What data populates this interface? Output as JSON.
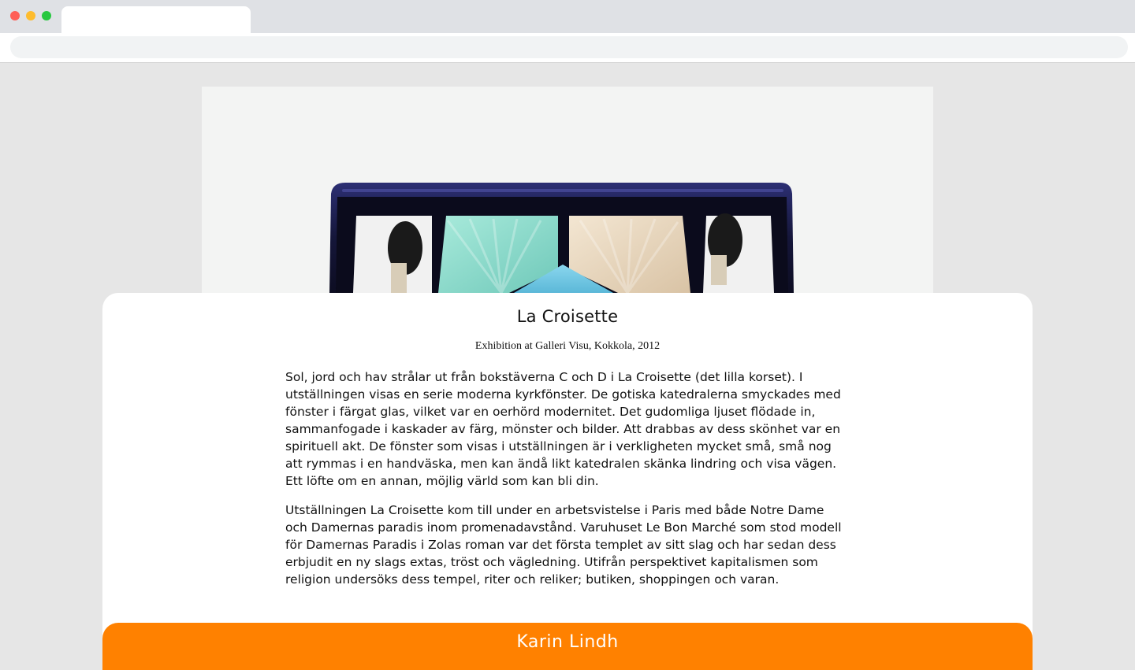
{
  "colors": {
    "accent": "#ff8100",
    "page_background": "#e6e6e6",
    "card_background": "#ffffff",
    "hero_background": "#f3f4f3"
  },
  "hero": {
    "image_subject": "eyeshadow-palette",
    "palette_colors": [
      "#1c1d4a",
      "#8fdccd",
      "#e8d7c0",
      "#6fc6e2"
    ]
  },
  "article": {
    "title": "La Croisette",
    "subtitle": "Exhibition at Galleri Visu, Kokkola, 2012",
    "paragraphs": [
      "Sol, jord och hav strålar ut från bokstäverna C och D i La Croisette (det lilla korset). I utställningen visas en serie moderna kyrkfönster. De gotiska katedralerna smyckades med fönster i färgat glas, vilket var en oerhörd modernitet. Det gudomliga ljuset flödade in, sammanfogade i kaskader av färg, mönster och bilder. Att drabbas av dess skönhet var en spirituell akt. De fönster som visas i utställningen är i verkligheten mycket små, små nog att rymmas i en handväska, men kan ändå likt katedralen skänka lindring och visa vägen. Ett löfte om en annan, möjlig värld som kan bli din.",
      "Utställningen La Croisette kom till under en arbetsvistelse i Paris med både Notre Dame och Damernas paradis inom promenadavstånd. Varuhuset Le Bon Marché som stod modell för Damernas Paradis i Zolas roman var det första templet av sitt slag och har sedan dess erbjudit en ny slags extas, tröst och vägledning. Utifrån perspektivet kapitalismen som religion undersöks dess tempel, riter och reliker; butiken, shoppingen och varan."
    ]
  },
  "footer": {
    "artist_name": "Karin Lindh"
  }
}
